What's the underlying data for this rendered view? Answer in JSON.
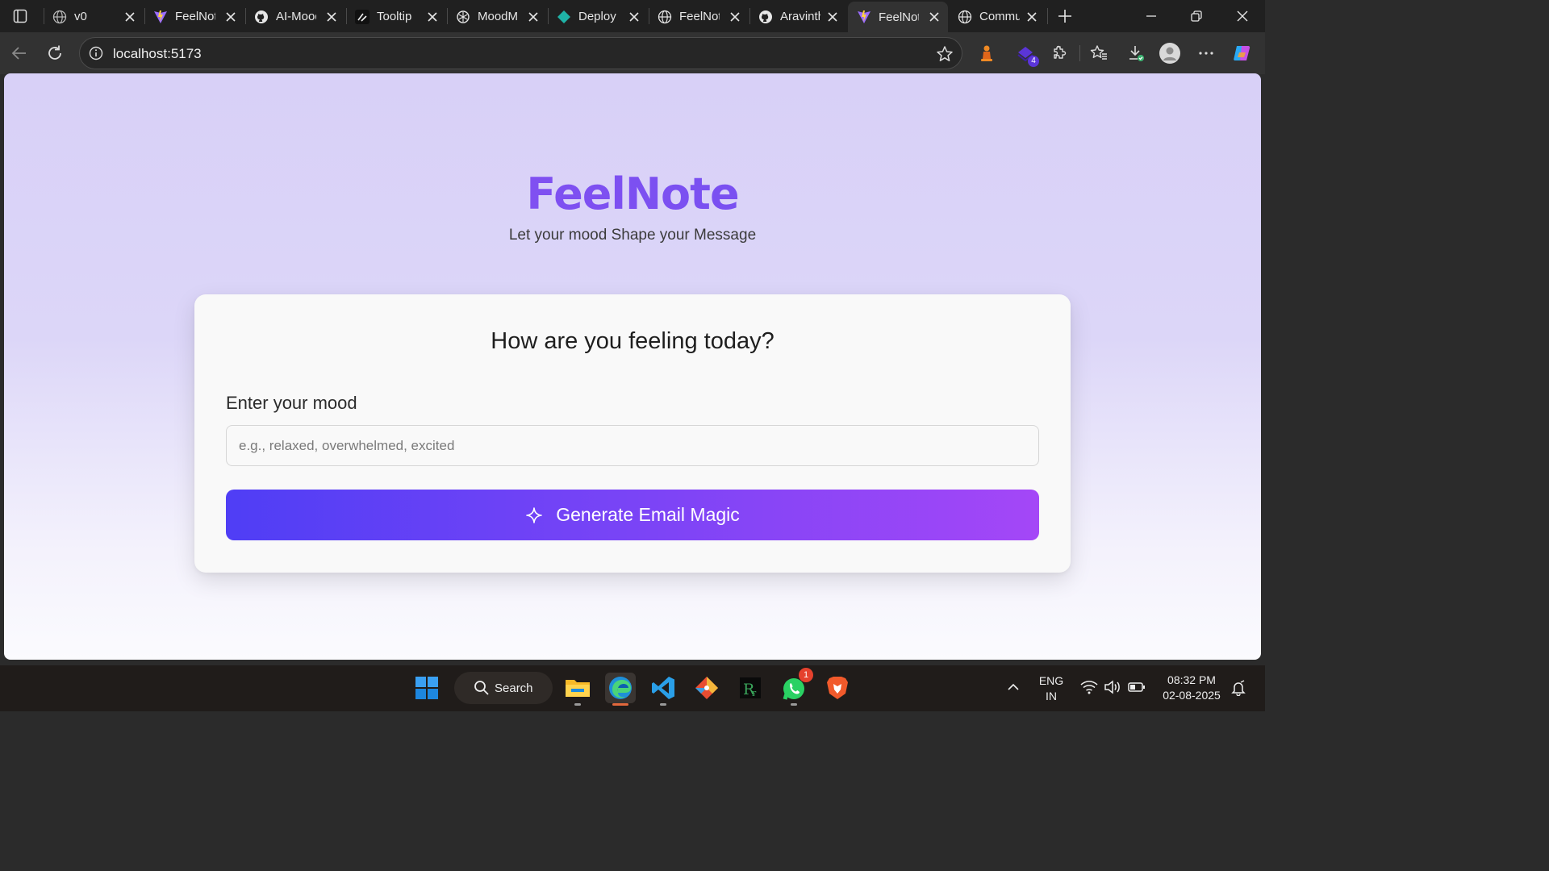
{
  "browser": {
    "tabs": [
      {
        "title": "v0",
        "icon": "globe-icon"
      },
      {
        "title": "FeelNote",
        "icon": "vite-icon"
      },
      {
        "title": "AI-Mood",
        "icon": "github-icon"
      },
      {
        "title": "Tooltip",
        "icon": "shadcn-icon"
      },
      {
        "title": "MoodMail",
        "icon": "openai-icon"
      },
      {
        "title": "Deploy",
        "icon": "deploy-icon"
      },
      {
        "title": "FeelNote",
        "icon": "globe-icon"
      },
      {
        "title": "Aravinth",
        "icon": "github-icon"
      },
      {
        "title": "FeelNote",
        "icon": "vite-icon",
        "active": true
      },
      {
        "title": "Community",
        "icon": "globe-icon"
      }
    ],
    "url": "localhost:5173",
    "extension_badge": "4"
  },
  "page": {
    "brand": "FeelNote",
    "tagline": "Let your mood Shape your Message",
    "card_title": "How are you feeling today?",
    "mood_label": "Enter your mood",
    "mood_placeholder": "e.g., relaxed, overwhelmed, excited",
    "mood_value": "",
    "generate_label": "Generate Email Magic",
    "colors": {
      "brand_start": "#8f52f2",
      "brand_end": "#6a4ef0",
      "button_start": "#4f3ef5",
      "button_end": "#a447f7",
      "background": "#d8d0f7"
    }
  },
  "taskbar": {
    "search_label": "Search",
    "apps": [
      "windows-start-icon",
      "file-explorer-icon",
      "edge-icon",
      "vscode-icon",
      "git-icon",
      "rstudio-icon",
      "whatsapp-icon",
      "brave-icon"
    ],
    "whatsapp_badge": "1",
    "language": "ENG",
    "region": "IN",
    "time": "08:32 PM",
    "date": "02-08-2025"
  }
}
